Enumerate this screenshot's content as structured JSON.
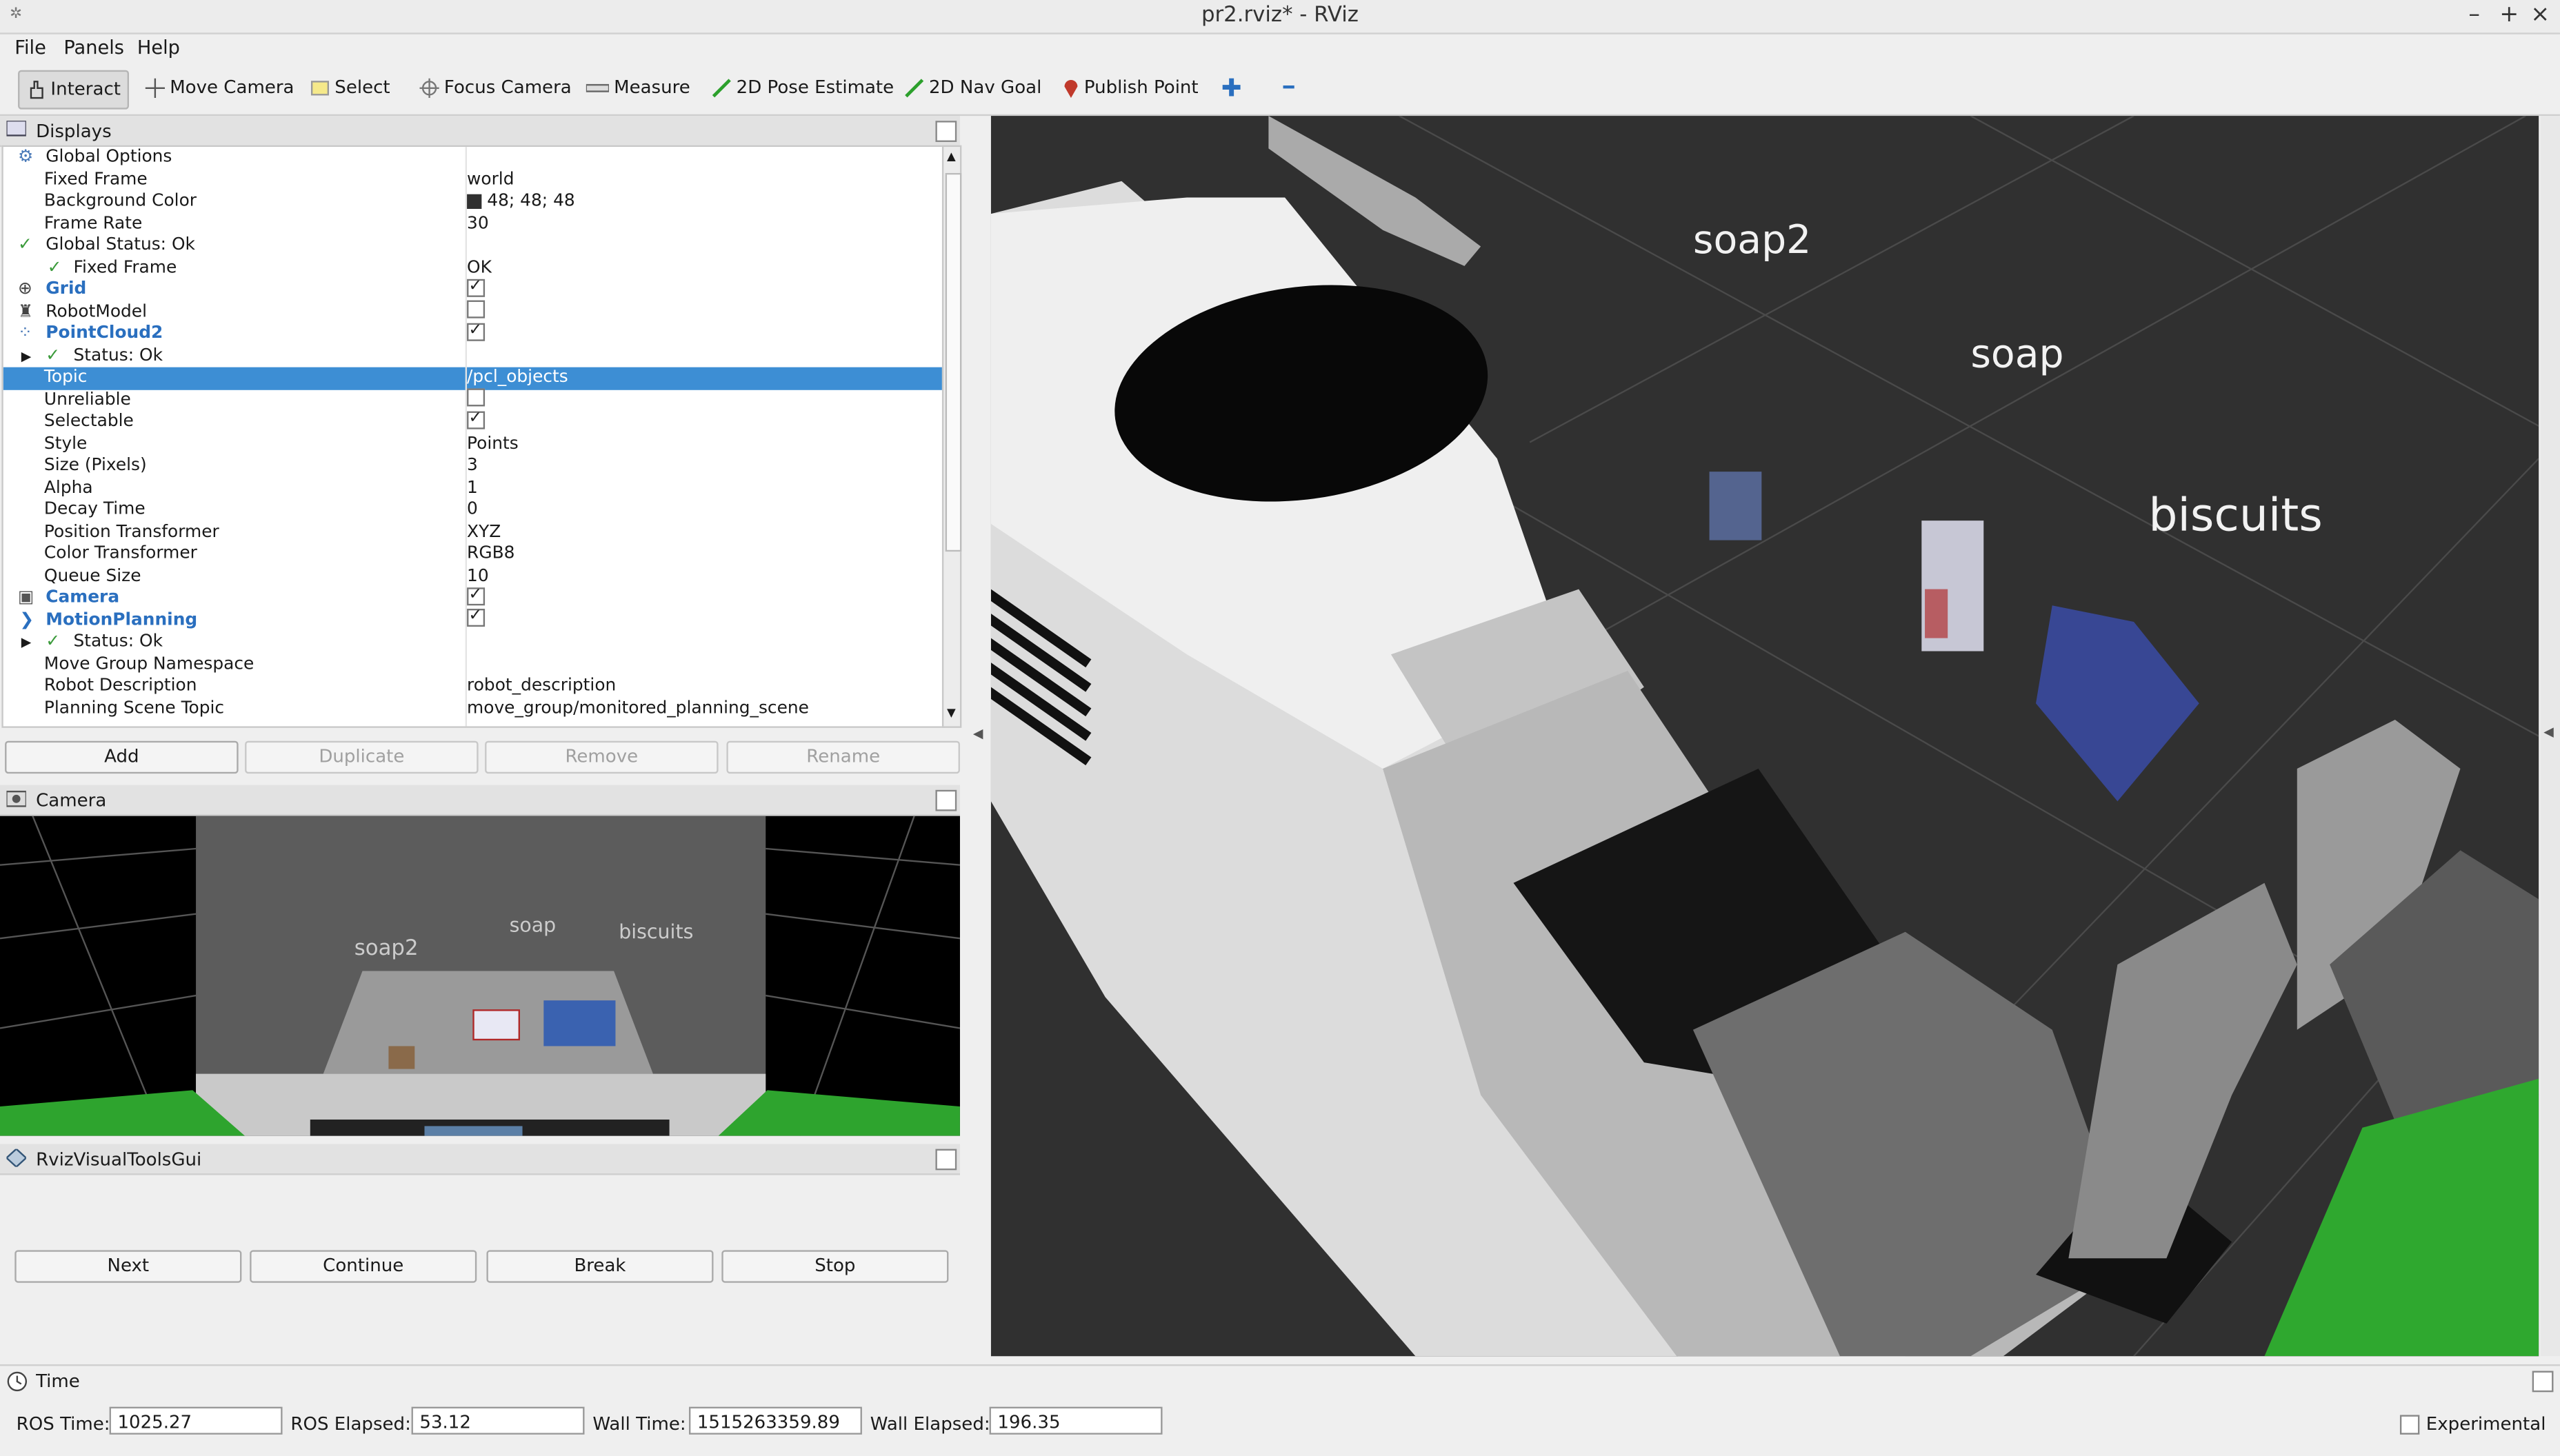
{
  "window": {
    "title": "pr2.rviz* - RViz"
  },
  "menu": [
    "File",
    "Panels",
    "Help"
  ],
  "toolbar": {
    "interact": "Interact",
    "move_camera": "Move Camera",
    "select": "Select",
    "focus_camera": "Focus Camera",
    "measure": "Measure",
    "pose_estimate": "2D Pose Estimate",
    "nav_goal": "2D Nav Goal",
    "publish_point": "Publish Point"
  },
  "displays": {
    "title": "Displays",
    "rows": [
      {
        "name": "Global Options",
        "value": ""
      },
      {
        "name": "Fixed Frame",
        "value": "world"
      },
      {
        "name": "Background Color",
        "value": "48; 48; 48"
      },
      {
        "name": "Frame Rate",
        "value": "30"
      },
      {
        "name": "Global Status: Ok",
        "value": ""
      },
      {
        "name": "Fixed Frame",
        "value": "OK"
      },
      {
        "name": "Grid",
        "value": ""
      },
      {
        "name": "RobotModel",
        "value": ""
      },
      {
        "name": "PointCloud2",
        "value": ""
      },
      {
        "name": "Status: Ok",
        "value": ""
      },
      {
        "name": "Topic",
        "value": "/pcl_objects"
      },
      {
        "name": "Unreliable",
        "value": ""
      },
      {
        "name": "Selectable",
        "value": ""
      },
      {
        "name": "Style",
        "value": "Points"
      },
      {
        "name": "Size (Pixels)",
        "value": "3"
      },
      {
        "name": "Alpha",
        "value": "1"
      },
      {
        "name": "Decay Time",
        "value": "0"
      },
      {
        "name": "Position Transformer",
        "value": "XYZ"
      },
      {
        "name": "Color Transformer",
        "value": "RGB8"
      },
      {
        "name": "Queue Size",
        "value": "10"
      },
      {
        "name": "Camera",
        "value": ""
      },
      {
        "name": "MotionPlanning",
        "value": ""
      },
      {
        "name": "Status: Ok",
        "value": ""
      },
      {
        "name": "Move Group Namespace",
        "value": ""
      },
      {
        "name": "Robot Description",
        "value": "robot_description"
      },
      {
        "name": "Planning Scene Topic",
        "value": "move_group/monitored_planning_scene"
      }
    ],
    "buttons": {
      "add": "Add",
      "duplicate": "Duplicate",
      "remove": "Remove",
      "rename": "Rename"
    }
  },
  "camera_panel": {
    "title": "Camera",
    "labels": [
      "soap2",
      "soap",
      "biscuits"
    ]
  },
  "tools_panel": {
    "title": "RvizVisualToolsGui",
    "buttons": {
      "next": "Next",
      "continue": "Continue",
      "break": "Break",
      "stop": "Stop"
    }
  },
  "view3d": {
    "labels": [
      "soap2",
      "soap",
      "biscuits"
    ]
  },
  "time_panel": {
    "title": "Time",
    "ros_time_label": "ROS Time:",
    "ros_time": "1025.27",
    "ros_elapsed_label": "ROS Elapsed:",
    "ros_elapsed": "53.12",
    "wall_time_label": "Wall Time:",
    "wall_time": "1515263359.89",
    "wall_elapsed_label": "Wall Elapsed:",
    "wall_elapsed": "196.35",
    "experimental": "Experimental"
  }
}
